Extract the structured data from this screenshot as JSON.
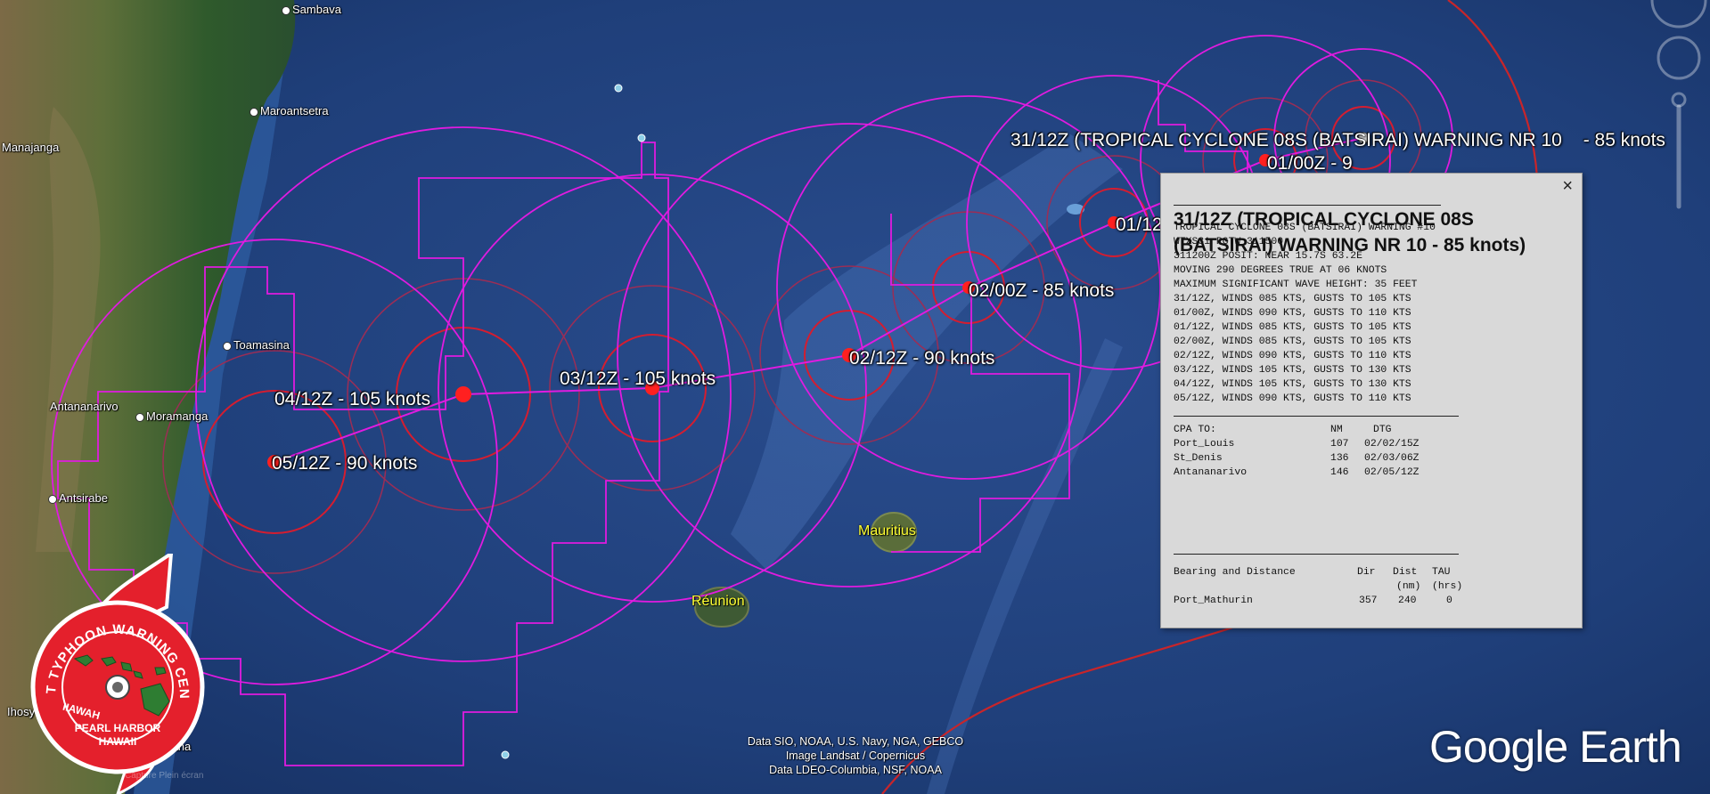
{
  "map_labels": {
    "places": [
      "Sambava",
      "Maroantsetra",
      "Manajanga",
      "Toamasina",
      "Antananarivo",
      "Moramanga",
      "Antsirabe",
      "Ihosy",
      "Jana"
    ],
    "islands": [
      "Mauritius",
      "Réunion"
    ]
  },
  "forecast_labels": {
    "header": "31/12Z (TROPICAL CYCLONE 08S (BATSIRAI) WARNING NR 10",
    "header_intensity": "- 85 knots",
    "points": [
      "01/00Z - 9",
      "01/12",
      "02/00Z - 85 knots",
      "02/12Z - 90 knots",
      "03/12Z - 105 knots",
      "04/12Z - 105 knots",
      "05/12Z - 90 knots"
    ]
  },
  "logo": {
    "top_text": "JOINT TYPHOON WARNING CENTER",
    "line1": "PEARL HARBOR",
    "line2": "HAWAII",
    "mirrored": "HAWAII",
    "faded_label": "Capture Plein écran"
  },
  "attribution": [
    "Data SIO, NOAA, U.S. Navy, NGA, GEBCO",
    "Image Landsat / Copernicus",
    "Data LDEO-Columbia, NSF, NOAA"
  ],
  "brand": "Google Earth",
  "popup": {
    "close_label": "×",
    "title": "31/12Z (TROPICAL CYCLONE 08S (BATSIRAI) WARNING NR 10 - 85 knots)",
    "body": [
      "TROPICAL CYCLONE 08S (BATSIRAI) WARNING #10",
      "WTXS31 PGTW 311500",
      "311200Z POSIT: NEAR 15.7S 63.2E",
      "MOVING 290 DEGREES TRUE AT 06 KNOTS",
      "MAXIMUM SIGNIFICANT WAVE HEIGHT: 35 FEET",
      "31/12Z, WINDS 085 KTS, GUSTS TO 105 KTS",
      "01/00Z, WINDS 090 KTS, GUSTS TO 110 KTS",
      "01/12Z, WINDS 085 KTS, GUSTS TO 105 KTS",
      "02/00Z, WINDS 085 KTS, GUSTS TO 105 KTS",
      "02/12Z, WINDS 090 KTS, GUSTS TO 110 KTS",
      "03/12Z, WINDS 105 KTS, GUSTS TO 130 KTS",
      "04/12Z, WINDS 105 KTS, GUSTS TO 130 KTS",
      "05/12Z, WINDS 090 KTS, GUSTS TO 110 KTS"
    ],
    "cpa": {
      "headers": [
        "CPA TO:",
        "NM",
        "DTG"
      ],
      "rows": [
        [
          "Port_Louis",
          "107",
          "02/02/15Z"
        ],
        [
          "St_Denis",
          "136",
          "02/03/06Z"
        ],
        [
          "Antananarivo",
          "146",
          "02/05/12Z"
        ]
      ]
    },
    "bearing": {
      "headers": [
        "Bearing and Distance",
        "Dir",
        "Dist",
        "TAU"
      ],
      "subheaders": [
        "(nm)",
        "(hrs)"
      ],
      "rows": [
        [
          "Port_Mathurin",
          "357",
          "240",
          "0"
        ]
      ]
    }
  }
}
